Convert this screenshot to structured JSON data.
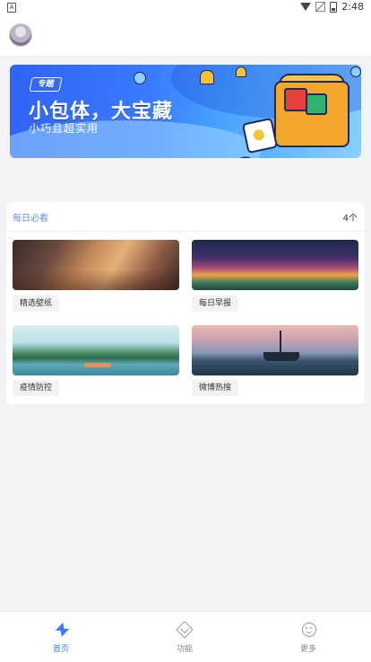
{
  "statusbar": {
    "left_icon": "notification-a-icon",
    "icons": [
      "wifi-icon",
      "no-signal-icon",
      "battery-icon"
    ],
    "time": "2:48"
  },
  "header": {
    "avatar": "user-avatar"
  },
  "banner": {
    "tag": "专题",
    "title": "小包体，大宝藏",
    "subtitle": "小巧且超实用",
    "accent": "#3a7bff"
  },
  "daily": {
    "title": "每日必看",
    "count": "4个",
    "items": [
      {
        "label": "精选壁纸",
        "image": "wallpaper-illustration"
      },
      {
        "label": "每日早报",
        "image": "daily-news-illustration"
      },
      {
        "label": "疫情防控",
        "image": "lake-landscape-illustration"
      },
      {
        "label": "微博热搜",
        "image": "fishing-boat-illustration"
      }
    ]
  },
  "bottom_nav": {
    "items": [
      {
        "label": "首页",
        "icon": "bolt-icon",
        "active": true
      },
      {
        "label": "功能",
        "icon": "cube-icon",
        "active": false
      },
      {
        "label": "更多",
        "icon": "smile-icon",
        "active": false
      }
    ],
    "active_color": "#3a7bff"
  }
}
